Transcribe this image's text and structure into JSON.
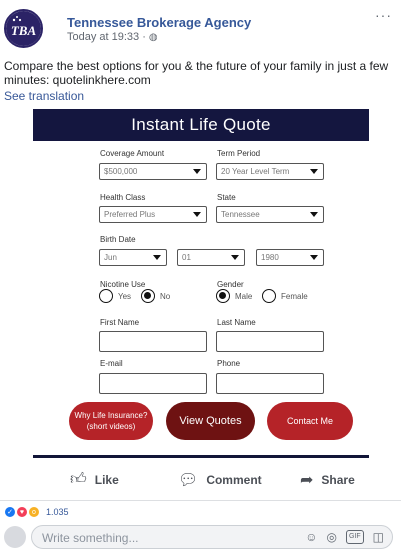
{
  "post": {
    "page_name": "Tennessee Brokerage Agency",
    "timestamp": "Today at 19:33 · ",
    "more": "···",
    "text": "Compare the best options for you & the future of your family in just a few minutes: quotelinkhere.com",
    "see_translation": "See translation",
    "logo_text": "TBA"
  },
  "quote": {
    "title": "Instant Life Quote",
    "coverage_label": "Coverage Amount",
    "coverage_value": "$500,000",
    "term_label": "Term Period",
    "term_value": "20 Year Level Term",
    "health_label": "Health Class",
    "health_value": "Preferred Plus",
    "state_label": "State",
    "state_value": "Tennessee",
    "birth_label": "Birth Date",
    "birth_month": "Jun",
    "birth_day": "01",
    "birth_year": "1980",
    "nicotine_label": "Nicotine Use",
    "yes_label": "Yes",
    "no_label": "No",
    "gender_label": "Gender",
    "male_label": "Male",
    "female_label": "Female",
    "first_name_label": "First Name",
    "last_name_label": "Last Name",
    "email_label": "E-mail",
    "phone_label": "Phone",
    "why_button_line1": "Why Life Insurance?",
    "why_button_line2": "(short videos)",
    "view_button": "View Quotes",
    "contact_button": "Contact Me"
  },
  "actions": {
    "like": "Like",
    "comment": "Comment",
    "share": "Share"
  },
  "reactions": {
    "count": "1.035"
  },
  "comment": {
    "placeholder": "Write something...",
    "gif": "GIF"
  }
}
